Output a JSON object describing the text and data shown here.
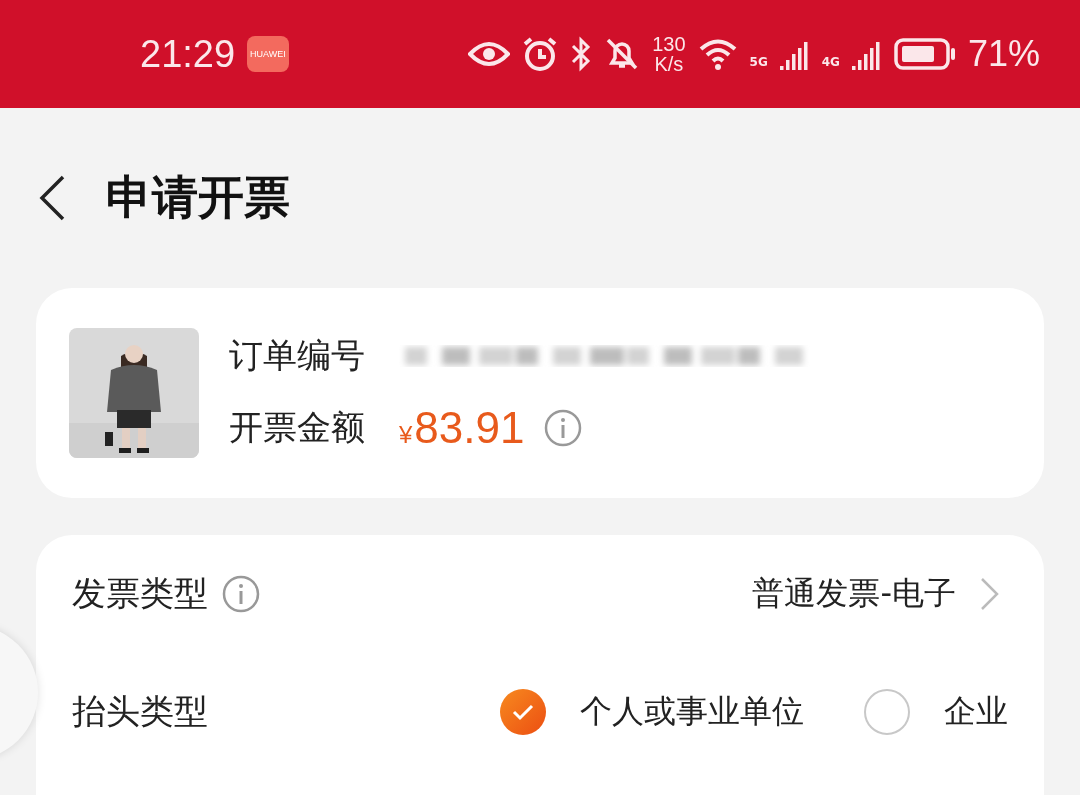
{
  "status_bar": {
    "time": "21:29",
    "app_badge": "HUAWEI",
    "speed_value": "130",
    "speed_unit": "K/s",
    "networks": [
      "5G",
      "4G"
    ],
    "battery": "71%"
  },
  "header": {
    "title": "申请开票"
  },
  "order_card": {
    "order_label": "订单编号",
    "amount_label": "开票金额",
    "currency": "¥",
    "amount": "83.91"
  },
  "invoice_form": {
    "invoice_type": {
      "label": "发票类型",
      "value": "普通发票-电子"
    },
    "title_type": {
      "label": "抬头类型",
      "options": [
        {
          "label": "个人或事业单位",
          "selected": true
        },
        {
          "label": "企业",
          "selected": false
        }
      ]
    }
  }
}
